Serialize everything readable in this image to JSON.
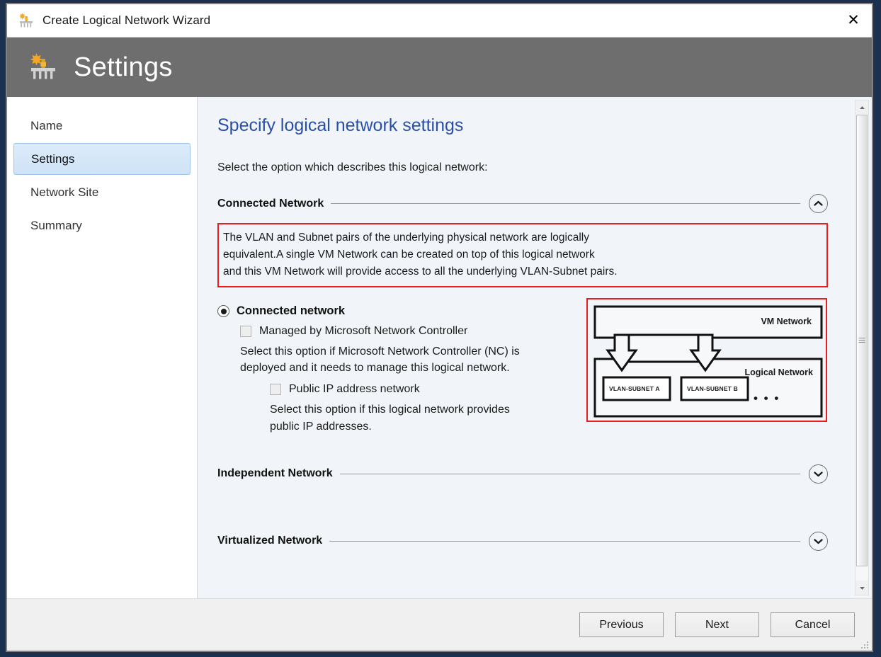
{
  "window": {
    "title": "Create Logical Network Wizard",
    "title_icon": "logical-network-icon",
    "close_label": "✕"
  },
  "header": {
    "title": "Settings",
    "icon": "logical-network-icon"
  },
  "sidebar": {
    "items": [
      {
        "label": "Name",
        "selected": false
      },
      {
        "label": "Settings",
        "selected": true
      },
      {
        "label": "Network Site",
        "selected": false
      },
      {
        "label": "Summary",
        "selected": false
      }
    ]
  },
  "main": {
    "page_title": "Specify logical network settings",
    "intro": "Select the option which describes this logical network:",
    "sections": [
      {
        "label": "Connected Network",
        "expanded": true,
        "toggle_icon": "chevron-up-icon"
      },
      {
        "label": "Independent Network",
        "expanded": false,
        "toggle_icon": "chevron-down-icon"
      },
      {
        "label": "Virtualized Network",
        "expanded": false,
        "toggle_icon": "chevron-down-icon"
      }
    ],
    "description": "The VLAN and Subnet pairs of the underlying physical network are logically equivalent.A single VM Network can be created on top of this logical network and this VM Network will provide access to all the underlying VLAN-Subnet pairs.",
    "description_lines": [
      "The VLAN and Subnet pairs of the underlying physical network are logically",
      "equivalent.A single VM Network can be created on top of this logical network",
      "and this VM Network will provide access to all the underlying VLAN-Subnet pairs."
    ],
    "options": {
      "connected_network": {
        "label": "Connected network",
        "checked": true
      },
      "managed_by_nc": {
        "label": "Managed by Microsoft Network Controller",
        "checked": false,
        "help": "Select this option if Microsoft Network Controller (NC) is deployed and it needs to manage this logical network.",
        "help_lines": [
          "Select this option if Microsoft Network Controller (NC) is",
          "deployed and it needs to manage this logical network."
        ]
      },
      "public_ip": {
        "label": "Public IP address network",
        "checked": false,
        "help": "Select this option if this logical network provides public IP addresses.",
        "help_lines": [
          "Select this option if this logical network provides",
          "public IP addresses."
        ]
      }
    },
    "diagram": {
      "vm_network_label": "VM Network",
      "logical_network_label": "Logical Network",
      "subnets": [
        "VLAN-SUBNET A",
        "VLAN-SUBNET B"
      ],
      "ellipsis": "• • •"
    }
  },
  "footer": {
    "buttons": [
      {
        "label": "Previous"
      },
      {
        "label": "Next"
      },
      {
        "label": "Cancel"
      }
    ]
  },
  "colors": {
    "header_band": "#6e6e6e",
    "page_title": "#2a4fa8",
    "content_bg": "#f1f5f9",
    "highlight_red": "#ee1b1b",
    "selection_blue": "#cfe3f7",
    "outer_frame": "#1c3050"
  }
}
